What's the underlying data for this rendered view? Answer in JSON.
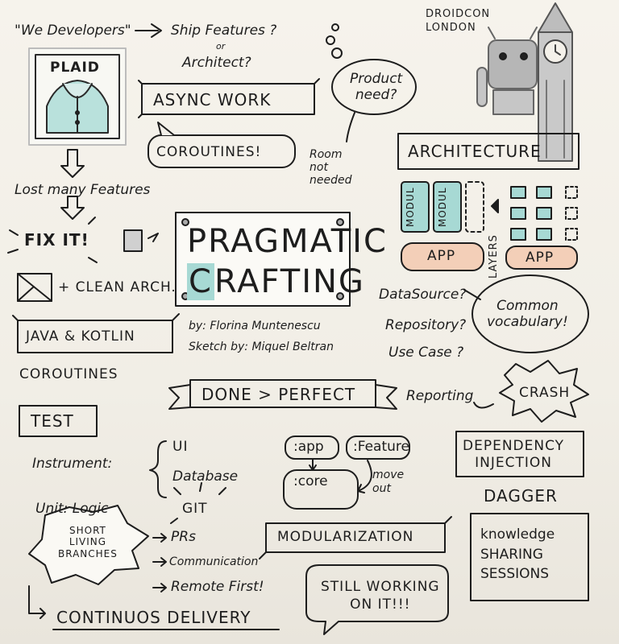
{
  "sketch": {
    "we_developers": "\"We Developers\"",
    "ship_features": "Ship Features ?",
    "or": "or",
    "architect": "Architect?",
    "plaid": "PLAID",
    "async_work": "ASYNC WORK",
    "coroutines_bubble": "COROUTINES!",
    "product_need": "Product\nneed?",
    "room_not_needed": "Room\nnot\nneeded",
    "droidcon": "DROIDCON\nLONDON",
    "architecture": "ARCHITECTURE",
    "modul_1": "MODUL",
    "modul_2": "MODUL",
    "app_left": "APP",
    "app_right": "APP",
    "layers": "LAYERS",
    "lost_features": "Lost many Features",
    "fix_it": "FIX IT!",
    "clean_arch": "+ CLEAN ARCH.",
    "pragmatic": "PRAGMATIC",
    "crafting": "RAFTING",
    "crafting_c": "C",
    "by_author": "by: Florina Muntenescu",
    "sketch_by": "Sketch by: Miquel Beltran",
    "datasource": "DataSource?",
    "repository": "Repository?",
    "use_case": "Use Case ?",
    "common_vocab": "Common\nvocabulary!",
    "java_kotlin": "JAVA & KOTLIN",
    "coroutines": "COROUTINES",
    "done_perfect": "DONE > PERFECT",
    "reporting": "Reporting",
    "crash": "CRASH",
    "test": "TEST",
    "instrument": "Instrument:",
    "ui": "UI",
    "database": "Database",
    "app_module": ":app",
    "feature_module": ":Feature",
    "core_module": ":core",
    "move_out": "move\nout",
    "dependency_injection": "DEPENDENCY\nINJECTION",
    "dagger": "DAGGER",
    "unit_logic": "Unit: Logic",
    "git": "GIT",
    "short_living": "SHORT\nLIVING\nBRANCHES",
    "prs": "PRs",
    "communication": "Communication",
    "remote_first": "Remote First!",
    "modularization": "MODULARIZATION",
    "knowledge": "knowledge\nSHARING\nSESSIONS",
    "still_working": "STILL WORKING\nON IT!!!",
    "continuous_delivery": "CONTINUOS DELIVERY"
  },
  "colors": {
    "ink": "#1d1d1d",
    "teal": "#a7d9d4",
    "peach": "#f3cfb8",
    "grey": "#b9b9b9",
    "paper": "#f4f1ea"
  }
}
